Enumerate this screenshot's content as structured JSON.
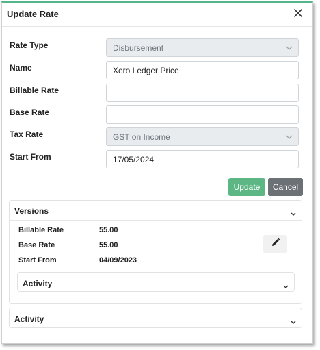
{
  "dialog": {
    "title": "Update Rate"
  },
  "form": {
    "rate_type": {
      "label": "Rate Type",
      "value": "Disbursement"
    },
    "name": {
      "label": "Name",
      "value": "Xero Ledger Price"
    },
    "billable_rate": {
      "label": "Billable Rate",
      "value": ""
    },
    "base_rate": {
      "label": "Base Rate",
      "value": ""
    },
    "tax_rate": {
      "label": "Tax Rate",
      "value": "GST on Income"
    },
    "start_from": {
      "label": "Start From",
      "value": "17/05/2024"
    }
  },
  "actions": {
    "update_label": "Update",
    "cancel_label": "Cancel"
  },
  "versions": {
    "title": "Versions",
    "rows": [
      {
        "label": "Billable Rate",
        "value": "55.00"
      },
      {
        "label": "Base Rate",
        "value": "55.00"
      },
      {
        "label": "Start From",
        "value": "04/09/2023"
      }
    ],
    "activity_title": "Activity"
  },
  "activity": {
    "title": "Activity"
  },
  "colors": {
    "accent": "#56b48a",
    "update_button": "#5cb785",
    "cancel_button": "#6b7175",
    "disabled_field": "#e9ecef"
  },
  "icons": {
    "close": "close-icon",
    "select_caret": "chevron-down-icon",
    "edit": "pencil-icon",
    "collapse": "chevron-down-icon"
  }
}
